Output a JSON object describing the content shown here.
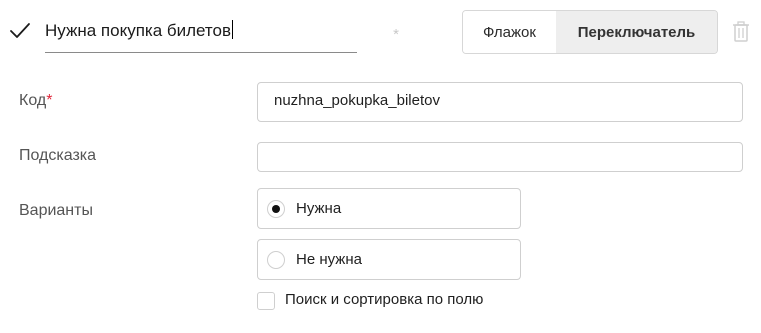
{
  "header": {
    "question_title": "Нужна покупка билетов",
    "required_star": "*",
    "type_options": [
      "Флажок",
      "Переключатель"
    ],
    "selected_type": "Переключатель",
    "icons": {
      "check": "checkmark-icon",
      "delete": "trash-icon"
    }
  },
  "form": {
    "code": {
      "label": "Код",
      "required_mark": "*",
      "value": "nuzhna_pokupka_biletov"
    },
    "hint": {
      "label": "Подсказка",
      "value": ""
    },
    "variants": {
      "label": "Варианты",
      "options": [
        {
          "label": "Нужна",
          "selected": true
        },
        {
          "label": "Не нужна",
          "selected": false
        }
      ]
    },
    "search_sort": {
      "label": "Поиск и сортировка по полю",
      "checked": false
    }
  },
  "colors": {
    "required": "#e0253a",
    "segment_active_bg": "#eeeeee",
    "border": "#cfcfcf"
  }
}
